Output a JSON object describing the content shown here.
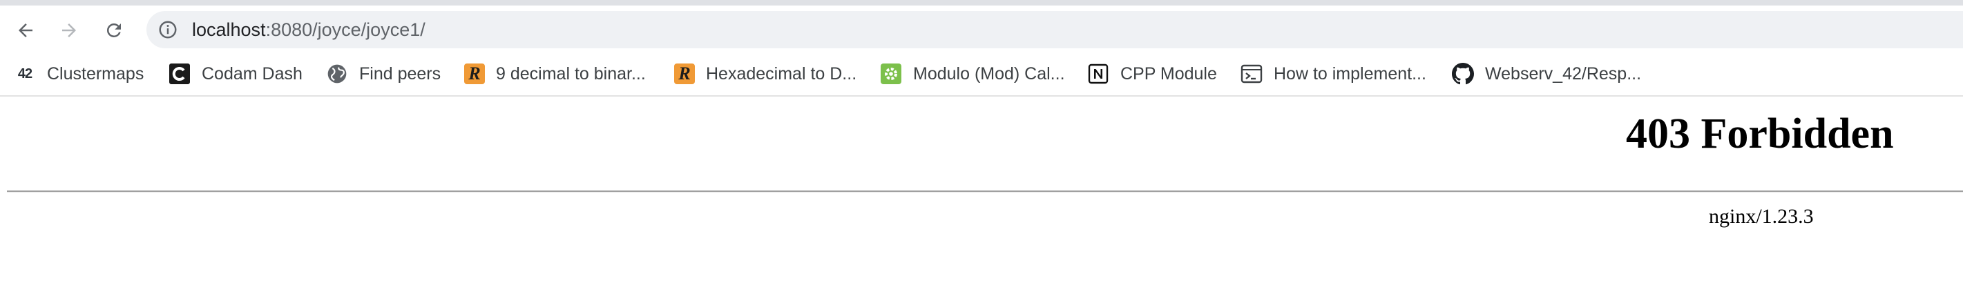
{
  "browser": {
    "address_bar": {
      "host": "localhost",
      "path": ":8080/joyce/joyce1/"
    },
    "nav": {
      "back_icon": "arrow-left-icon",
      "forward_icon": "arrow-right-icon",
      "reload_icon": "reload-icon",
      "info_icon": "site-info-icon"
    }
  },
  "bookmarks": [
    {
      "label": "Clustermaps",
      "icon": "42-logo-icon"
    },
    {
      "label": "Codam Dash",
      "icon": "codam-logo-icon"
    },
    {
      "label": "Find peers",
      "icon": "globe-icon"
    },
    {
      "label": "9 decimal to binar...",
      "icon": "r-logo-icon"
    },
    {
      "label": "Hexadecimal to D...",
      "icon": "r-logo-icon"
    },
    {
      "label": "Modulo (Mod) Cal...",
      "icon": "calculator-gear-icon"
    },
    {
      "label": "CPP Module",
      "icon": "notion-icon"
    },
    {
      "label": "How to implement...",
      "icon": "terminal-window-icon"
    },
    {
      "label": "Webserv_42/Resp...",
      "icon": "github-icon"
    }
  ],
  "page": {
    "title": "403 Forbidden",
    "footer": "nginx/1.23.3"
  },
  "colors": {
    "omnibox_bg": "#eff1f4",
    "icon_gray": "#5f6368",
    "r_icon_bg": "#f09a36",
    "modulo_icon_bg": "#7cc04b"
  }
}
